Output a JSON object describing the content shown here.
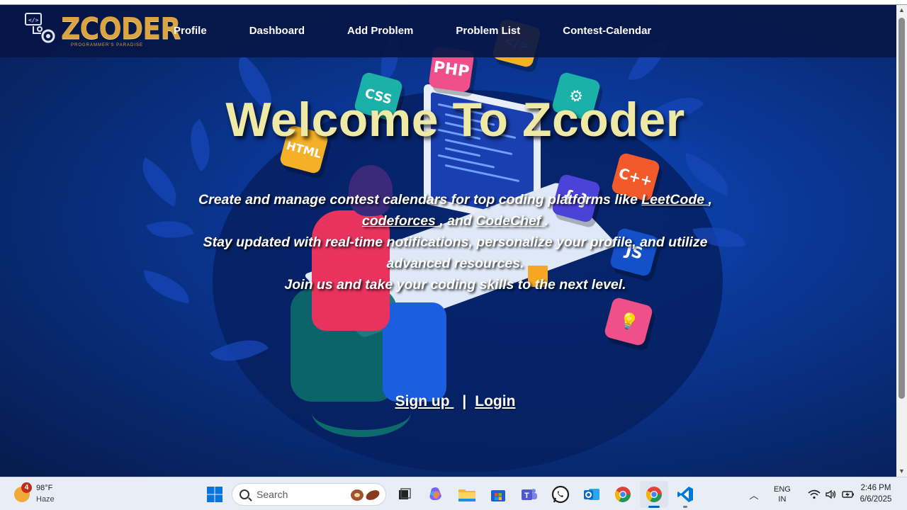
{
  "nav": {
    "logo_text": "ZCODER",
    "logo_tagline": "PROGRAMMER'S PARADISE",
    "links": [
      "Profile",
      "Dashboard",
      "Add Problem",
      "Problem List",
      "Contest-Calendar"
    ]
  },
  "hero": {
    "title": "Welcome To Zcoder",
    "desc_part1": "Create and manage contest calendars for top coding platforms like ",
    "link_leetcode": "LeetCode ",
    "desc_comma1": ", ",
    "link_codeforces": "codeforces ",
    "desc_and": ", and ",
    "link_codechef": "CodeChef ",
    "desc_period": ".",
    "line2": "Stay updated with real-time notifications, personalize your profile, and utilize advanced resources.",
    "line3": "Join us and take your coding skills to the next level."
  },
  "auth": {
    "signup": "Sign up ",
    "separator": "|",
    "login": "Login"
  },
  "decor": {
    "tiles": [
      "PHP",
      "CSS",
      "HTML",
      "C++",
      "{ }",
      "JS",
      "</>"
    ]
  },
  "taskbar": {
    "weather_badge": "4",
    "weather_temp": "98°F",
    "weather_cond": "Haze",
    "search_placeholder": "Search",
    "apps": [
      "start-icon",
      "task-view-icon",
      "copilot-icon",
      "file-explorer-icon",
      "store-icon",
      "teams-icon",
      "whatsapp-icon",
      "outlook-icon",
      "chrome-icon",
      "chrome-active-icon",
      "vscode-icon"
    ],
    "lang_line1": "ENG",
    "lang_line2": "IN",
    "time": "2:46 PM",
    "date": "6/6/2025"
  },
  "colors": {
    "title": "#efe9a6",
    "logo": "#d9a441",
    "navbar": "#061646",
    "accent": "#0067c0"
  }
}
